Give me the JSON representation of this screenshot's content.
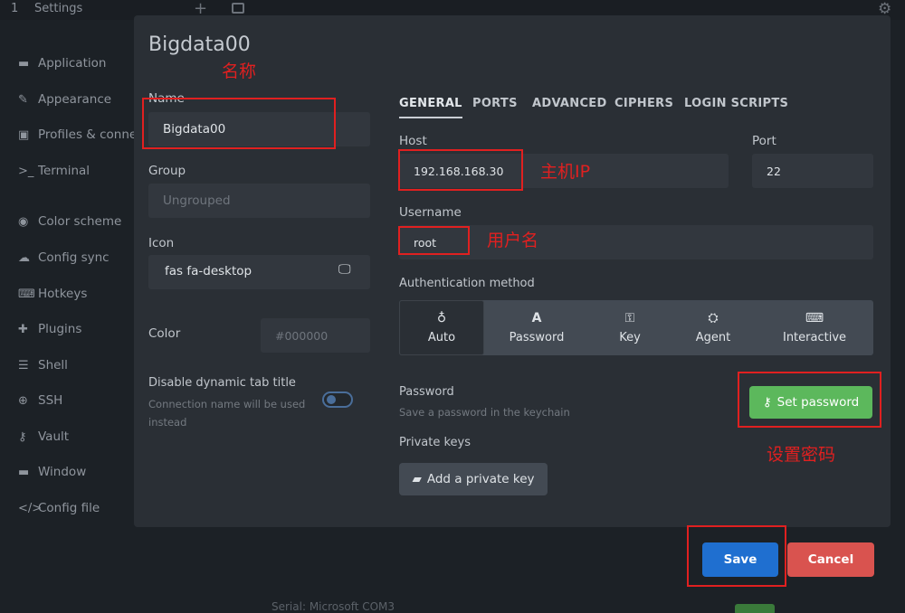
{
  "topbar": {
    "tab_number": "1",
    "tab_title": "Settings",
    "plus": "+",
    "gear": "⚙"
  },
  "sidebar": {
    "items": [
      {
        "label": "Application",
        "icon": "window-icon"
      },
      {
        "label": "Appearance",
        "icon": "brush-icon"
      },
      {
        "label": "Profiles & conne",
        "icon": "profiles-icon"
      },
      {
        "label": "Terminal",
        "icon": "terminal-icon"
      },
      {
        "label": "Color scheme",
        "icon": "palette-icon"
      },
      {
        "label": "Config sync",
        "icon": "cloud-icon"
      },
      {
        "label": "Hotkeys",
        "icon": "keyboard-icon"
      },
      {
        "label": "Plugins",
        "icon": "puzzle-icon"
      },
      {
        "label": "Shell",
        "icon": "list-icon"
      },
      {
        "label": "SSH",
        "icon": "globe-icon"
      },
      {
        "label": "Vault",
        "icon": "key-icon"
      },
      {
        "label": "Window",
        "icon": "window-icon"
      },
      {
        "label": "Config file",
        "icon": "code-icon"
      }
    ]
  },
  "modal": {
    "title": "Bigdata00",
    "left": {
      "name_label": "Name",
      "name_value": "Bigdata00",
      "group_label": "Group",
      "group_placeholder": "Ungrouped",
      "icon_label": "Icon",
      "icon_value": "fas fa-desktop",
      "color_label": "Color",
      "color_placeholder": "#000000",
      "disable_title_label": "Disable dynamic tab title",
      "disable_title_help_1": "Connection name will be used",
      "disable_title_help_2": "instead"
    },
    "tabs": [
      "GENERAL",
      "PORTS",
      "ADVANCED",
      "CIPHERS",
      "LOGIN SCRIPTS"
    ],
    "general": {
      "host_label": "Host",
      "host_value": "192.168.168.30",
      "port_label": "Port",
      "port_value": "22",
      "username_label": "Username",
      "username_value": "root",
      "auth_label": "Authentication method",
      "auth_methods": [
        {
          "label": "Auto",
          "icon": "lightbulb-icon",
          "glyph": "♁"
        },
        {
          "label": "Password",
          "icon": "text-icon",
          "glyph": "A"
        },
        {
          "label": "Key",
          "icon": "key-icon",
          "glyph": "⚿"
        },
        {
          "label": "Agent",
          "icon": "agent-icon",
          "glyph": "⛭"
        },
        {
          "label": "Interactive",
          "icon": "keyboard-icon",
          "glyph": "⌨"
        }
      ],
      "selected_auth": "Auto",
      "password_label": "Password",
      "password_help": "Save a password in the keychain",
      "set_password_label": "Set password",
      "private_keys_label": "Private keys",
      "add_key_label": "Add a private key"
    }
  },
  "footer": {
    "save_label": "Save",
    "cancel_label": "Cancel"
  },
  "annotations": {
    "name": "名称",
    "host": "主机IP",
    "username": "用户名",
    "password": "设置密码"
  },
  "bottom_text": "Serial: Microsoft   COM3",
  "colors": {
    "accent_blue": "#1f6fd0",
    "success_green": "#5cb85c",
    "danger_red": "#d9534f",
    "annotation_red": "#e02020"
  }
}
